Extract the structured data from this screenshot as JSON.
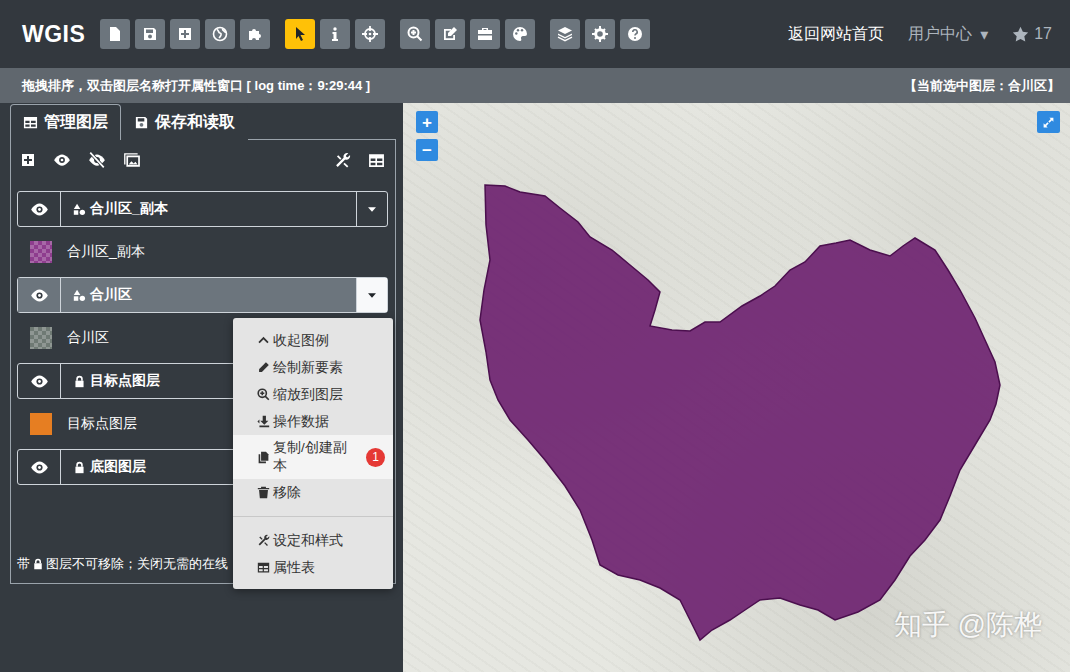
{
  "app": {
    "logo": "WGIS"
  },
  "toolbar": [
    {
      "buttons": [
        {
          "selected": false
        },
        {
          "selected": false
        },
        {
          "selected": false
        },
        {
          "selected": false
        },
        {
          "selected": false
        }
      ]
    },
    {
      "buttons": [
        {
          "selected": true
        },
        {
          "selected": false
        },
        {
          "selected": false
        }
      ]
    },
    {
      "buttons": [
        {
          "selected": false
        },
        {
          "selected": false
        },
        {
          "selected": false
        },
        {
          "selected": false
        }
      ]
    },
    {
      "buttons": [
        {
          "selected": false
        },
        {
          "selected": false
        },
        {
          "selected": false
        }
      ]
    }
  ],
  "nav": {
    "home": "返回网站首页",
    "user_center": "用户中心",
    "user_caret": "▾",
    "star_count": "17"
  },
  "info_bar": {
    "hint": "拖拽排序，双击图层名称打开属性窗口 [ log time：9:29:44 ]",
    "current_layer": "【当前选中图层：合川区】"
  },
  "panel_tabs": [
    {
      "label": "管理图层",
      "selected": true
    },
    {
      "label": "保存和读取",
      "selected": false
    }
  ],
  "layers": [
    {
      "name": "合川区_副本",
      "legend": "合川区_副本",
      "locked": false,
      "visible": true,
      "selected": false,
      "menu_open": false,
      "kind": "polygon",
      "color": "#8e3d8e"
    },
    {
      "name": "合川区",
      "legend": "合川区",
      "locked": false,
      "visible": true,
      "selected": true,
      "menu_open": true,
      "kind": "polygon",
      "color": "#6f7a74"
    },
    {
      "name": "目标点图层",
      "legend": "目标点图层",
      "locked": true,
      "visible": true,
      "selected": false,
      "menu_open": false,
      "kind": "point",
      "color": "#e67e22"
    },
    {
      "name": "底图图层",
      "legend": null,
      "locked": true,
      "visible": true,
      "selected": false,
      "menu_open": false,
      "kind": "basemap",
      "color": "#343a40"
    }
  ],
  "note": {
    "before": "带",
    "after": "图层不可移除；关闭无需的在线"
  },
  "context_menu": [
    {
      "kind": "item",
      "label": "收起图例",
      "badge": null,
      "selected": false
    },
    {
      "kind": "item",
      "label": "绘制新要素",
      "badge": null,
      "selected": false
    },
    {
      "kind": "item",
      "label": "缩放到图层",
      "badge": null,
      "selected": false
    },
    {
      "kind": "item",
      "label": "操作数据",
      "badge": null,
      "selected": false
    },
    {
      "kind": "item",
      "label": "复制/创建副本",
      "badge": "1",
      "selected": true
    },
    {
      "kind": "item",
      "label": "移除",
      "badge": null,
      "selected": false
    },
    {
      "kind": "separator",
      "label": null,
      "badge": null,
      "selected": false
    },
    {
      "kind": "item",
      "label": "设定和样式",
      "badge": null,
      "selected": false
    },
    {
      "kind": "item",
      "label": "属性表",
      "badge": null,
      "selected": false
    }
  ],
  "map": {
    "zoom_in": "+",
    "zoom_out": "−",
    "watermark": "知乎 @陈桦"
  }
}
